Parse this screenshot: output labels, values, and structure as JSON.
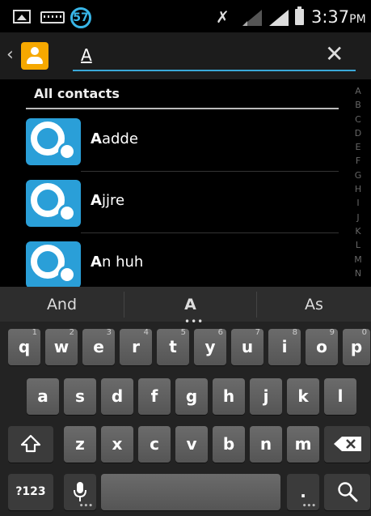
{
  "status_bar": {
    "notification_count": "57",
    "time": "3:37",
    "ampm": "PM"
  },
  "search": {
    "query": "A",
    "back_glyph": "‹",
    "clear_glyph": "✕"
  },
  "contacts": {
    "section_title": "All contacts",
    "items": [
      {
        "highlight": "A",
        "rest": "adde"
      },
      {
        "highlight": "A",
        "rest": "jjre"
      },
      {
        "highlight": "A",
        "rest": "n huh"
      }
    ],
    "index_letters": [
      "A",
      "B",
      "C",
      "D",
      "E",
      "F",
      "G",
      "H",
      "I",
      "J",
      "K",
      "L",
      "M",
      "N"
    ]
  },
  "keyboard": {
    "suggestions": [
      "And",
      "A",
      "As"
    ],
    "row1": [
      {
        "label": "q",
        "hint": "1"
      },
      {
        "label": "w",
        "hint": "2"
      },
      {
        "label": "e",
        "hint": "3"
      },
      {
        "label": "r",
        "hint": "4"
      },
      {
        "label": "t",
        "hint": "5"
      },
      {
        "label": "y",
        "hint": "6"
      },
      {
        "label": "u",
        "hint": "7"
      },
      {
        "label": "i",
        "hint": "8"
      },
      {
        "label": "o",
        "hint": "9"
      },
      {
        "label": "p",
        "hint": "0"
      }
    ],
    "row2": [
      "a",
      "s",
      "d",
      "f",
      "g",
      "h",
      "j",
      "k",
      "l"
    ],
    "row3": [
      "z",
      "x",
      "c",
      "v",
      "b",
      "n",
      "m"
    ],
    "symbols_label": "?123",
    "period_label": "."
  }
}
